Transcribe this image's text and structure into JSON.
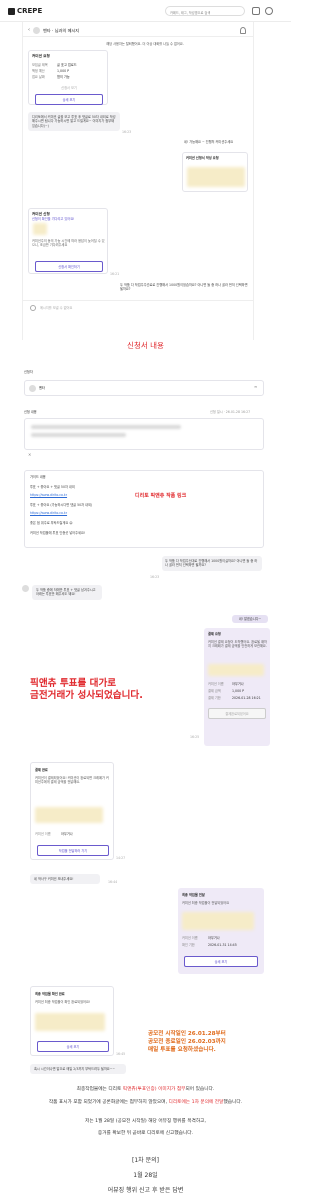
{
  "header": {
    "logo_text": "CREPE",
    "search_placeholder": "카페드, 태그, 작성명으로 검색"
  },
  "chat": {
    "title": "벤타 · 님과의 메시지",
    "input_placeholder": "메시지를 보낼 수 없어요",
    "intro_line": "해당 사용자는 탈퇴했어요. 더 이상 대화를 나눌 수 없어요.",
    "request_card": {
      "title": "커미션 요청",
      "rows": [
        {
          "label": "모집글 제목",
          "value": "글 표고 업로드"
        },
        {
          "label": "책정 예산",
          "value": "1,000 P"
        },
        {
          "label": "접요 날짜",
          "value": "협의 가능"
        }
      ],
      "status": "신청서 보기",
      "button": "상세 보기"
    },
    "msg_first": "디리토에서 커미션 글을 보고 투표 후 댓글로 50자 내외로 작성해주시면 됩니다 가능하시면 알고 드릴게요~ 이미지가 첨부돼 있습니다(~)",
    "msg_right_1": "네! 가능해요 ~ 진행처 커미션주세요",
    "card_proposal": "커미션 신청서 작성 요청",
    "card_accept_title": "커미션 신청",
    "card_accept_sub": "신청이 확인을 기다리고 있어요!",
    "card_accept_body": "커미션주의 동의 가능 시간에 따라 응답이 늦어질 수 있으니, 조금만 기다려주세요",
    "card_accept_btn": "신청서 확인하기",
    "msg_right_2": "두 작품 다 작업주주선료로 진행해서 1000원이었습까요? 아니면 둘 중 하나 골라 먼저 선택하면 될까요?",
    "time_1": "16:23",
    "time_2": "16:21"
  },
  "sections": {
    "heading_1": "신청서 내용",
    "form_label_1": "신청자",
    "form_name": "벤타",
    "form_label_2": "신청 내용",
    "form_date": "신청 일시 · 26.01.28 16:27",
    "form_guide": "가이드 내용",
    "form_lines": [
      "투표 + 좋아요 + 댓글 50자 내외",
      "https://www.dirito.co.kr",
      "투표 + 좋아요 (가능하시다면 댓글 50자 내외)",
      "https://www.dirito.co.kr",
      "좋은 점 위주로 부탁드릴게요 😊",
      "커미션 작업물에 투표 인증샷 넣어주세요!"
    ],
    "annot_dirito": "디리토 픽앤츄 작품 링크"
  },
  "chat2": {
    "msg_a": "두 작품 다 작업주신대로 진행해서 1000원이실까요? 아니면 둘 중 하나 골라 먼저 선택하면 될까요?",
    "msg_b": "두 작품 중에 저에만 투표 + 댓글 남겨주시고 아래는 투표만 해주셔도 돼요!",
    "msg_c": "네! 알겠습니다~",
    "payment_card": {
      "title": "결제 요청",
      "body": "커미션 결제 요청이 도착했어요. 완료될 때까지 크레페가 결제 금액을 안전하게 보관해요.",
      "rows": [
        {
          "label": "커미션 이름",
          "value": "아무거나"
        },
        {
          "label": "결제 금액",
          "value": "1,000 P"
        },
        {
          "label": "결제 기한",
          "value": "2026-01-28 16:21"
        }
      ],
      "button": "결제완료되었어요"
    },
    "red_headline_1": "픽앤츄 투표를 대가로",
    "red_headline_2": "금전거래가 성사되었습니다.",
    "done_card": {
      "title": "결제 완료",
      "body": "커미션이 결제되었어요! 커미션이 완료되면 크레페가 커미션주에게 결제 금액을 전달해요.",
      "rows": [
        {
          "label": "커미션 이름",
          "value": "아무거나"
        }
      ],
      "button": "작업물 전달하러 가기"
    },
    "msg_d": "네 작사구 커미션 보내주세요!",
    "delivery_card": {
      "title": "최종 작업물 전달",
      "body": "커미션 최종 작업물이 전달되었어요",
      "rows": [
        {
          "label": "커미션 이름",
          "value": "아무거나"
        },
        {
          "label": "확인 기한",
          "value": "2026-01-31 14:45"
        }
      ],
      "button": "상세 보기"
    },
    "confirm_card": {
      "title": "최종 작업물 확인 완료",
      "body": "커미션 최종 작업물이 확인 완료되었어요!",
      "button": "상세 보기"
    },
    "orange_note": [
      "공모전 시작일인 26.01.28부터",
      "공모전 종료일인 26.02.03까지",
      "매일 투표를 요청하셨습니다."
    ],
    "msg_e": "혹시 시간이나면 말으로 매일 2/3까지 부탁드려두 될까요~~",
    "time_a": "16:23",
    "time_b": "16:25",
    "time_c": "14:27",
    "time_d": "16:44",
    "time_e": "16:45"
  },
  "bottom": {
    "line1_a": "최종작업물에는 디리토 ",
    "line1_hl": "픽앤츄(투표인증) 이미지가 첨부",
    "line1_b": "되어 있습니다.",
    "line2_a": "작품 표시가 포함 되었기에 공론화글에는 첨부하지 않았으며, ",
    "line2_hl": "디리토에는 1차 문의에 전달",
    "line2_b": "했습니다.",
    "line3": "저는 1월 28일 (공모전 시작일) 해당 어뷰징 행위를 목격하고,",
    "line4": "증거를 확보한 뒤 곧바로 디리토에 신고했습니다.",
    "q1": "[1차 문의]",
    "q2": "1월 28일",
    "q3": "어뷰징 행위 신고 후 받은 답변"
  },
  "icons": [
    "logo-mark-icon",
    "bell-icon",
    "user-icon",
    "back-arrow-icon",
    "person-icon",
    "close-icon",
    "send-icon"
  ],
  "colors": {
    "accent": "#6a5acd",
    "red": "#e0292d",
    "orange": "#e06a1a",
    "purple_card": "#efeaf7"
  }
}
